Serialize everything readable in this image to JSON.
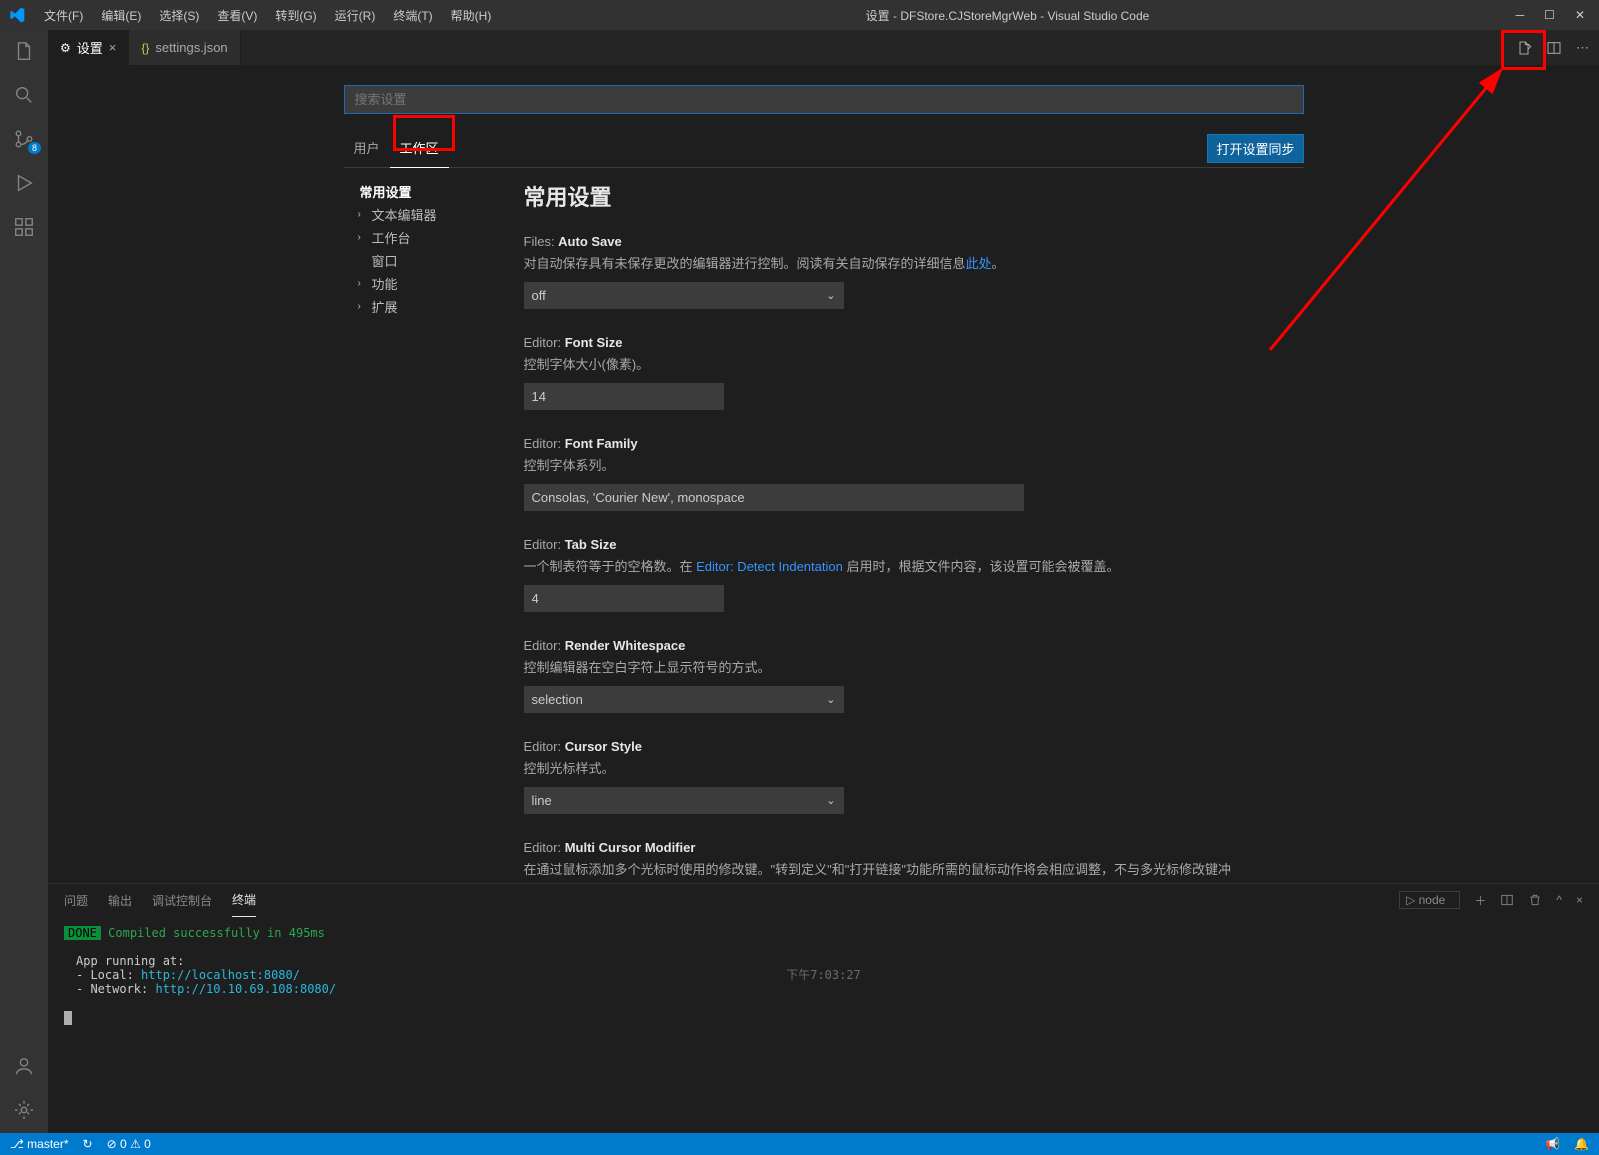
{
  "title": "设置 - DFStore.CJStoreMgrWeb - Visual Studio Code",
  "menu": [
    "文件(F)",
    "编辑(E)",
    "选择(S)",
    "查看(V)",
    "转到(G)",
    "运行(R)",
    "终端(T)",
    "帮助(H)"
  ],
  "activity_badge": "8",
  "tabs": {
    "t0": {
      "label": "设置"
    },
    "t1": {
      "label": "settings.json"
    }
  },
  "search": {
    "placeholder": "搜索设置"
  },
  "scope": {
    "user": "用户",
    "workspace": "工作区",
    "sync": "打开设置同步"
  },
  "toc": {
    "common": "常用设置",
    "text_editor": "文本编辑器",
    "workbench": "工作台",
    "window": "窗口",
    "features": "功能",
    "extensions": "扩展"
  },
  "settings": {
    "header": "常用设置",
    "autosave": {
      "pre": "Files: ",
      "name": "Auto Save",
      "desc1": "对自动保存具有未保存更改的编辑器进行控制。阅读有关自动保存的详细信息",
      "link": "此处",
      "desc2": "。",
      "value": "off"
    },
    "fontsize": {
      "pre": "Editor: ",
      "name": "Font Size",
      "desc": "控制字体大小(像素)。",
      "value": "14"
    },
    "fontfamily": {
      "pre": "Editor: ",
      "name": "Font Family",
      "desc": "控制字体系列。",
      "value": "Consolas, 'Courier New', monospace"
    },
    "tabsize": {
      "pre": "Editor: ",
      "name": "Tab Size",
      "desc1": "一个制表符等于的空格数。在 ",
      "link": "Editor: Detect Indentation",
      "desc2": " 启用时，根据文件内容，该设置可能会被覆盖。",
      "value": "4"
    },
    "whitespace": {
      "pre": "Editor: ",
      "name": "Render Whitespace",
      "desc": "控制编辑器在空白字符上显示符号的方式。",
      "value": "selection"
    },
    "cursorstyle": {
      "pre": "Editor: ",
      "name": "Cursor Style",
      "desc": "控制光标样式。",
      "value": "line"
    },
    "multicursor": {
      "pre": "Editor: ",
      "name": "Multi Cursor Modifier",
      "desc": "在通过鼠标添加多个光标时使用的修改键。\"转到定义\"和\"打开链接\"功能所需的鼠标动作将会相应调整，不与多光标修改键冲"
    }
  },
  "panel": {
    "tabs": {
      "problems": "问题",
      "output": "输出",
      "debug": "调试控制台",
      "terminal": "终端"
    },
    "selector": "node",
    "timestamp": "下午7:03:27",
    "done": "DONE",
    "compiled": "Compiled successfully in 495ms",
    "running": "App running at:",
    "local_lbl": "- Local:   ",
    "local_url": "http://localhost:8080/",
    "net_lbl": "- Network: ",
    "net_url": "http://10.10.69.108:8080/"
  },
  "status": {
    "branch": "master*",
    "sync": "↻",
    "errors": "⊘ 0 ⚠ 0"
  }
}
